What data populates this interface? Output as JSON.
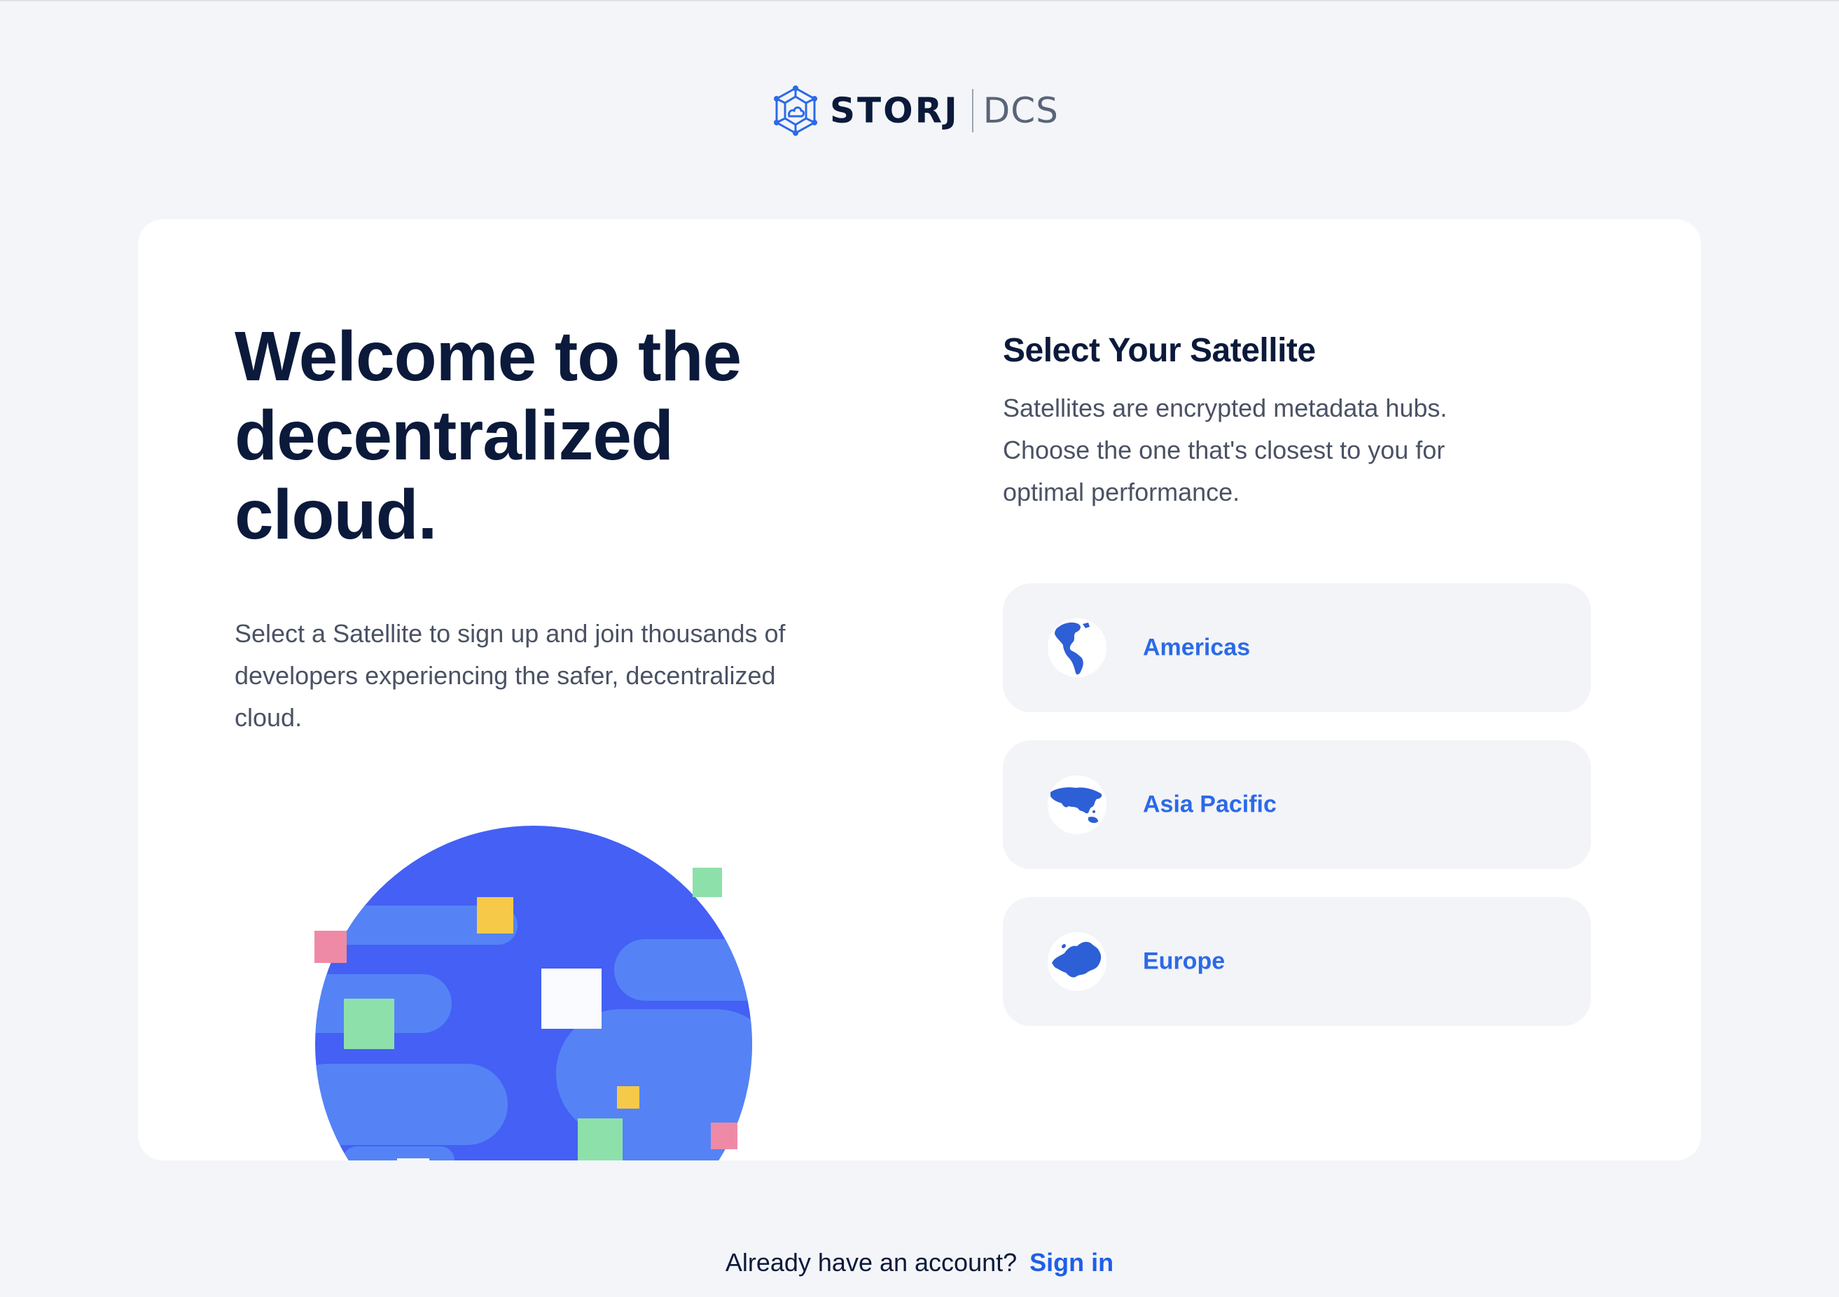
{
  "header": {
    "brand": "STORJ",
    "product": "DCS",
    "logo_icon": "storj-cube-icon"
  },
  "welcome": {
    "title": "Welcome to the decentralized cloud.",
    "description": "Select a Satellite to sign up and join thousands of developers experiencing the safer, decentralized cloud."
  },
  "satellite": {
    "title": "Select Your Satellite",
    "description": "Satellites are encrypted metadata hubs. Choose the one that's closest to you for optimal performance.",
    "options": [
      {
        "label": "Americas",
        "icon": "americas-globe-icon"
      },
      {
        "label": "Asia Pacific",
        "icon": "asia-pacific-globe-icon"
      },
      {
        "label": "Europe",
        "icon": "europe-globe-icon"
      }
    ]
  },
  "footer": {
    "prompt": "Already have an account?",
    "sign_in": "Sign in"
  },
  "colors": {
    "background": "#f4f5f8",
    "card": "#ffffff",
    "heading": "#0b1a3b",
    "accent": "#2b6ae8",
    "globe_dark": "#4460f5",
    "globe_light": "#5583f5"
  }
}
